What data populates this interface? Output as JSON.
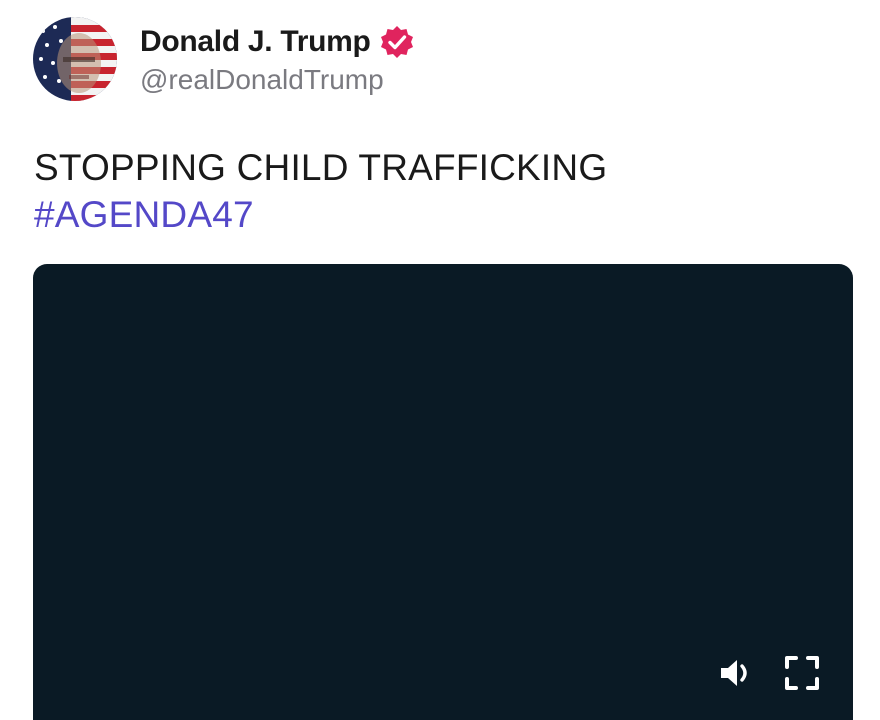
{
  "author": {
    "display_name": "Donald J. Trump",
    "handle": "@realDonaldTrump",
    "verified": true,
    "verified_color": "#e0245e"
  },
  "post": {
    "text": "STOPPING CHILD TRAFFICKING",
    "hashtag": "#AGENDA47",
    "hashtag_color": "#5448c8"
  },
  "video": {
    "background": "#0a1a25",
    "controls": {
      "volume_icon": "speaker-icon",
      "fullscreen_icon": "fullscreen-icon"
    }
  }
}
